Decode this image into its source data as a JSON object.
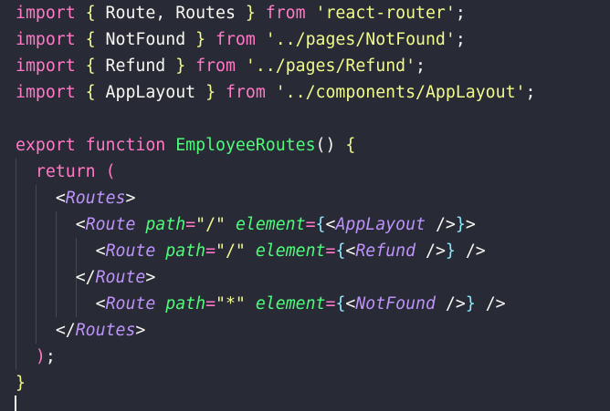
{
  "editor": {
    "colors": {
      "background": "#282a36",
      "keyword": "#ff79c6",
      "plain": "#f8f8f2",
      "brace": "#f1fa8c",
      "string": "#f1fa8c",
      "function": "#50fa7b",
      "component": "#bd93f9",
      "attribute": "#50fa7b",
      "jsx_brace": "#8be9fd"
    },
    "lines": [
      {
        "tokens": [
          {
            "t": "import",
            "k": "keyword"
          },
          {
            "t": " ",
            "k": "plain"
          },
          {
            "t": "{",
            "k": "brace"
          },
          {
            "t": " Route, Routes ",
            "k": "plain"
          },
          {
            "t": "}",
            "k": "brace"
          },
          {
            "t": " ",
            "k": "plain"
          },
          {
            "t": "from",
            "k": "keyword"
          },
          {
            "t": " ",
            "k": "plain"
          },
          {
            "t": "'react-router'",
            "k": "string"
          },
          {
            "t": ";",
            "k": "plain"
          }
        ]
      },
      {
        "tokens": [
          {
            "t": "import",
            "k": "keyword"
          },
          {
            "t": " ",
            "k": "plain"
          },
          {
            "t": "{",
            "k": "brace"
          },
          {
            "t": " NotFound ",
            "k": "plain"
          },
          {
            "t": "}",
            "k": "brace"
          },
          {
            "t": " ",
            "k": "plain"
          },
          {
            "t": "from",
            "k": "keyword"
          },
          {
            "t": " ",
            "k": "plain"
          },
          {
            "t": "'../pages/NotFound'",
            "k": "string"
          },
          {
            "t": ";",
            "k": "plain"
          }
        ]
      },
      {
        "tokens": [
          {
            "t": "import",
            "k": "keyword"
          },
          {
            "t": " ",
            "k": "plain"
          },
          {
            "t": "{",
            "k": "brace"
          },
          {
            "t": " Refund ",
            "k": "plain"
          },
          {
            "t": "}",
            "k": "brace"
          },
          {
            "t": " ",
            "k": "plain"
          },
          {
            "t": "from",
            "k": "keyword"
          },
          {
            "t": " ",
            "k": "plain"
          },
          {
            "t": "'../pages/Refund'",
            "k": "string"
          },
          {
            "t": ";",
            "k": "plain"
          }
        ]
      },
      {
        "tokens": [
          {
            "t": "import",
            "k": "keyword"
          },
          {
            "t": " ",
            "k": "plain"
          },
          {
            "t": "{",
            "k": "brace"
          },
          {
            "t": " AppLayout ",
            "k": "plain"
          },
          {
            "t": "}",
            "k": "brace"
          },
          {
            "t": " ",
            "k": "plain"
          },
          {
            "t": "from",
            "k": "keyword"
          },
          {
            "t": " ",
            "k": "plain"
          },
          {
            "t": "'../components/AppLayout'",
            "k": "string"
          },
          {
            "t": ";",
            "k": "plain"
          }
        ]
      },
      {
        "tokens": []
      },
      {
        "tokens": [
          {
            "t": "export",
            "k": "keyword"
          },
          {
            "t": " ",
            "k": "plain"
          },
          {
            "t": "function",
            "k": "keyword"
          },
          {
            "t": " ",
            "k": "plain"
          },
          {
            "t": "EmployeeRoutes",
            "k": "function"
          },
          {
            "t": "() ",
            "k": "plain"
          },
          {
            "t": "{",
            "k": "brace"
          }
        ]
      },
      {
        "tokens": [
          {
            "t": "  ",
            "k": "plain"
          },
          {
            "t": "return",
            "k": "keyword"
          },
          {
            "t": " ",
            "k": "plain"
          },
          {
            "t": "(",
            "k": "keyword"
          }
        ]
      },
      {
        "tokens": [
          {
            "t": "    ",
            "k": "plain"
          },
          {
            "t": "<",
            "k": "plain"
          },
          {
            "t": "Routes",
            "k": "component"
          },
          {
            "t": ">",
            "k": "plain"
          }
        ]
      },
      {
        "tokens": [
          {
            "t": "      ",
            "k": "plain"
          },
          {
            "t": "<",
            "k": "plain"
          },
          {
            "t": "Route",
            "k": "component"
          },
          {
            "t": " ",
            "k": "plain"
          },
          {
            "t": "path",
            "k": "attribute"
          },
          {
            "t": "=",
            "k": "keyword"
          },
          {
            "t": "\"/\"",
            "k": "string"
          },
          {
            "t": " ",
            "k": "plain"
          },
          {
            "t": "element",
            "k": "attribute"
          },
          {
            "t": "=",
            "k": "keyword"
          },
          {
            "t": "{",
            "k": "jsx_brace"
          },
          {
            "t": "<",
            "k": "plain"
          },
          {
            "t": "AppLayout",
            "k": "component"
          },
          {
            "t": " />",
            "k": "plain"
          },
          {
            "t": "}",
            "k": "jsx_brace"
          },
          {
            "t": ">",
            "k": "plain"
          }
        ]
      },
      {
        "tokens": [
          {
            "t": "        ",
            "k": "plain"
          },
          {
            "t": "<",
            "k": "plain"
          },
          {
            "t": "Route",
            "k": "component"
          },
          {
            "t": " ",
            "k": "plain"
          },
          {
            "t": "path",
            "k": "attribute"
          },
          {
            "t": "=",
            "k": "keyword"
          },
          {
            "t": "\"/\"",
            "k": "string"
          },
          {
            "t": " ",
            "k": "plain"
          },
          {
            "t": "element",
            "k": "attribute"
          },
          {
            "t": "=",
            "k": "keyword"
          },
          {
            "t": "{",
            "k": "jsx_brace"
          },
          {
            "t": "<",
            "k": "plain"
          },
          {
            "t": "Refund",
            "k": "component"
          },
          {
            "t": " />",
            "k": "plain"
          },
          {
            "t": "}",
            "k": "jsx_brace"
          },
          {
            "t": " />",
            "k": "plain"
          }
        ]
      },
      {
        "tokens": [
          {
            "t": "      ",
            "k": "plain"
          },
          {
            "t": "</",
            "k": "plain"
          },
          {
            "t": "Route",
            "k": "component"
          },
          {
            "t": ">",
            "k": "plain"
          }
        ]
      },
      {
        "tokens": [
          {
            "t": "        ",
            "k": "plain"
          },
          {
            "t": "<",
            "k": "plain"
          },
          {
            "t": "Route",
            "k": "component"
          },
          {
            "t": " ",
            "k": "plain"
          },
          {
            "t": "path",
            "k": "attribute"
          },
          {
            "t": "=",
            "k": "keyword"
          },
          {
            "t": "\"*\"",
            "k": "string"
          },
          {
            "t": " ",
            "k": "plain"
          },
          {
            "t": "element",
            "k": "attribute"
          },
          {
            "t": "=",
            "k": "keyword"
          },
          {
            "t": "{",
            "k": "jsx_brace"
          },
          {
            "t": "<",
            "k": "plain"
          },
          {
            "t": "NotFound",
            "k": "component"
          },
          {
            "t": " />",
            "k": "plain"
          },
          {
            "t": "}",
            "k": "jsx_brace"
          },
          {
            "t": " />",
            "k": "plain"
          }
        ]
      },
      {
        "tokens": [
          {
            "t": "    ",
            "k": "plain"
          },
          {
            "t": "</",
            "k": "plain"
          },
          {
            "t": "Routes",
            "k": "component"
          },
          {
            "t": ">",
            "k": "plain"
          }
        ]
      },
      {
        "tokens": [
          {
            "t": "  ",
            "k": "plain"
          },
          {
            "t": ")",
            "k": "keyword"
          },
          {
            "t": ";",
            "k": "plain"
          }
        ]
      },
      {
        "tokens": [
          {
            "t": "}",
            "k": "brace"
          }
        ]
      }
    ]
  }
}
